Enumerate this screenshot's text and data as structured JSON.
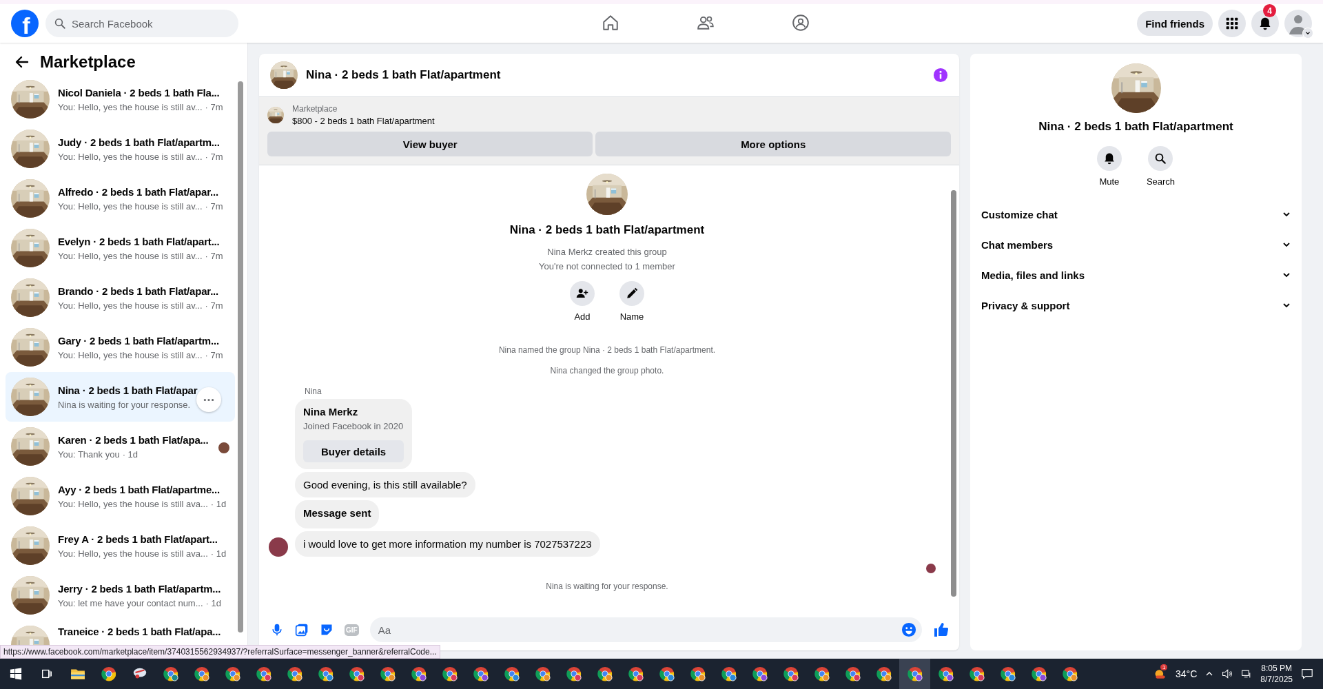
{
  "header": {
    "logo_text": "f",
    "search": {
      "placeholder": "Search Facebook"
    },
    "nav": [
      {
        "kind": "home",
        "selected": false
      },
      {
        "kind": "friends",
        "selected": false
      },
      {
        "kind": "groups",
        "selected": false
      }
    ],
    "find_friends": "Find friends",
    "notification_count": "4"
  },
  "sidebar": {
    "title": "Marketplace",
    "conversations": [
      {
        "name": "Nicol Daniela · 2 beds 1 bath Fla...",
        "preview": "You: Hello, yes the house is still av...",
        "time": "· 7m",
        "selected": false,
        "seen": false
      },
      {
        "name": "Judy · 2 beds 1 bath Flat/apartm...",
        "preview": "You: Hello, yes the house is still av...",
        "time": "· 7m",
        "selected": false,
        "seen": false
      },
      {
        "name": "Alfredo · 2 beds 1 bath Flat/apar...",
        "preview": "You: Hello, yes the house is still av...",
        "time": "· 7m",
        "selected": false,
        "seen": false
      },
      {
        "name": "Evelyn · 2 beds 1 bath Flat/apart...",
        "preview": "You: Hello, yes the house is still av...",
        "time": "· 7m",
        "selected": false,
        "seen": false
      },
      {
        "name": "Brando · 2 beds 1 bath Flat/apar...",
        "preview": "You: Hello, yes the house is still av...",
        "time": "· 7m",
        "selected": false,
        "seen": false
      },
      {
        "name": "Gary · 2 beds 1 bath Flat/apartm...",
        "preview": "You: Hello, yes the house is still av...",
        "time": "· 7m",
        "selected": false,
        "seen": false
      },
      {
        "name": "Nina · 2 beds 1 bath Flat/apar",
        "preview": "Nina is waiting for your response.",
        "selected": true,
        "seen": false
      },
      {
        "name": "Karen · 2 beds 1 bath Flat/apa...",
        "preview": "You: Thank you",
        "time": "· 1d",
        "selected": false,
        "seen": true
      },
      {
        "name": "Ayy · 2 beds 1 bath Flat/apartme...",
        "preview": "You: Hello, yes the house is still ava...",
        "time": "· 1d",
        "selected": false,
        "seen": false
      },
      {
        "name": "Frey A · 2 beds 1 bath Flat/apart...",
        "preview": "You: Hello, yes the house is still ava...",
        "time": "· 1d",
        "selected": false,
        "seen": false
      },
      {
        "name": "Jerry · 2 beds 1 bath Flat/apartm...",
        "preview": "You: let me have your contact num...",
        "time": "· 1d",
        "selected": false,
        "seen": false
      },
      {
        "name": "Traneice · 2 beds 1 bath Flat/apa...",
        "selected": false,
        "seen": false
      }
    ]
  },
  "chat": {
    "title": "Nina · 2 beds 1 bath Flat/apartment",
    "banner": {
      "label": "Marketplace",
      "listing": "$800 - 2 beds 1 bath Flat/apartment",
      "buttons": [
        "View buyer",
        "More options"
      ]
    },
    "intro": {
      "title": "Nina · 2 beds 1 bath Flat/apartment",
      "lines": [
        "Nina Merkz created this group",
        "You're not connected to 1 member"
      ],
      "actions": [
        {
          "kind": "add",
          "label": "Add"
        },
        {
          "kind": "edit",
          "label": "Name"
        }
      ]
    },
    "events": [
      "Nina named the group Nina · 2 beds 1 bath Flat/apartment.",
      "Nina changed the group photo."
    ],
    "sender": "Nina",
    "messages": [
      {
        "kind": "card",
        "title": "Nina Merkz",
        "subtitle": "Joined Facebook in 2020",
        "button": "Buyer details"
      },
      {
        "kind": "text",
        "text": "Good evening, is this still available?",
        "bold": false,
        "avatar": false
      },
      {
        "kind": "text",
        "text": "Message sent",
        "bold": true,
        "avatar": false
      },
      {
        "kind": "text",
        "text": "i would love to get more information my number is 7027537223",
        "bold": false,
        "avatar": true
      }
    ],
    "footer_note": "Nina is waiting for your response.",
    "composer": {
      "gif": "GIF",
      "placeholder": "Aa"
    }
  },
  "details": {
    "title": "Nina · 2 beds 1 bath Flat/apartment",
    "actions": [
      {
        "kind": "mute",
        "label": "Mute"
      },
      {
        "kind": "search",
        "label": "Search"
      }
    ],
    "sections": [
      {
        "label": "Customize chat",
        "expanded": false
      },
      {
        "label": "Chat members",
        "expanded": false
      },
      {
        "label": "Media, files and links",
        "expanded": false
      },
      {
        "label": "Privacy & support",
        "expanded": false
      }
    ]
  },
  "status_url": "https://www.facebook.com/marketplace/item/3740315562934937/?referralSurface=messenger_banner&referralCode...",
  "taskbar": {
    "apps": [
      {
        "kind": "start",
        "selected": false
      },
      {
        "kind": "taskview",
        "selected": false
      },
      {
        "kind": "folder",
        "selected": false
      },
      {
        "kind": "browser",
        "selected": false
      },
      {
        "kind": "app",
        "selected": false
      },
      {
        "kind": "profile",
        "color": "#1a8a8a",
        "selected": false
      },
      {
        "kind": "profile",
        "color": "#e8902a",
        "selected": false
      },
      {
        "kind": "profile",
        "color": "#e8902a",
        "selected": false
      },
      {
        "kind": "profile",
        "color": "#d93a5a",
        "selected": false
      },
      {
        "kind": "profile",
        "color": "#e8902a",
        "selected": false
      },
      {
        "kind": "profile",
        "color": "#2a8ad9",
        "selected": false
      },
      {
        "kind": "profile",
        "color": "#d93a5a",
        "selected": false
      },
      {
        "kind": "profile",
        "color": "#e8902a",
        "selected": false
      },
      {
        "kind": "profile",
        "color": "#8a4ad9",
        "selected": false
      },
      {
        "kind": "profile",
        "color": "#d93a5a",
        "selected": false
      },
      {
        "kind": "profile",
        "color": "#8a4ad9",
        "selected": false
      },
      {
        "kind": "profile",
        "color": "#2a8ad9",
        "selected": false
      },
      {
        "kind": "profile",
        "color": "#e8902a",
        "selected": false
      },
      {
        "kind": "profile",
        "color": "#d93a5a",
        "selected": false
      },
      {
        "kind": "profile",
        "color": "#e8902a",
        "selected": false
      },
      {
        "kind": "profile",
        "color": "#d93a5a",
        "selected": false
      },
      {
        "kind": "profile",
        "color": "#2a8ad9",
        "selected": false
      },
      {
        "kind": "profile",
        "color": "#e8902a",
        "selected": false
      },
      {
        "kind": "profile",
        "color": "#2a8ad9",
        "selected": false
      },
      {
        "kind": "profile",
        "color": "#8a4ad9",
        "selected": false
      },
      {
        "kind": "profile",
        "color": "#d93a5a",
        "selected": false
      },
      {
        "kind": "profile",
        "color": "#e8902a",
        "selected": false
      },
      {
        "kind": "profile",
        "color": "#d93a5a",
        "selected": false
      },
      {
        "kind": "profile",
        "color": "#e8902a",
        "selected": false
      },
      {
        "kind": "profile",
        "color": "#8a4ad9",
        "selected": true
      },
      {
        "kind": "profile",
        "color": "#8a4ad9",
        "selected": false
      },
      {
        "kind": "profile",
        "color": "#d93a5a",
        "selected": false
      },
      {
        "kind": "profile",
        "color": "#2a8ad9",
        "selected": false
      },
      {
        "kind": "profile",
        "color": "#8a4ad9",
        "selected": false
      },
      {
        "kind": "profile",
        "color": "#e8902a",
        "selected": false
      }
    ],
    "weather_badge": "1",
    "temperature": "34°C",
    "time": "8:05 PM",
    "date": "8/7/2025"
  }
}
